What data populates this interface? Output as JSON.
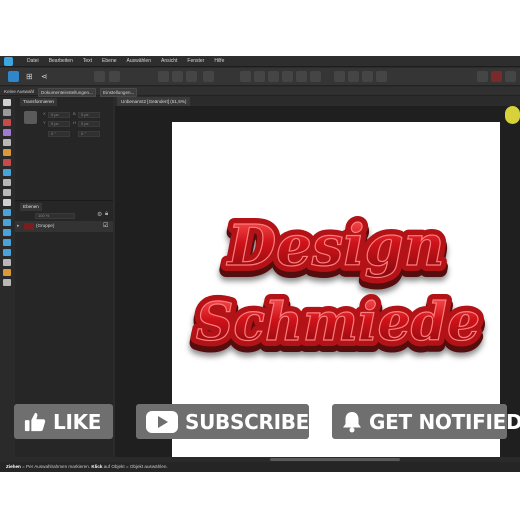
{
  "menubar": {
    "items": [
      "Datei",
      "Bearbeiten",
      "Text",
      "Ebene",
      "Auswählen",
      "Ansicht",
      "Fenster",
      "Hilfe"
    ]
  },
  "contextbar": {
    "selection": "Keine Auswahl",
    "document_settings": "Dokumenteinstellungen...",
    "preferences": "Einstellungen..."
  },
  "panels": {
    "transform_tab": "Transformieren",
    "fields": [
      "0 px",
      "0 px",
      "0 px",
      "0 px",
      "0 °",
      "0 °"
    ],
    "layers_tab": "Ebenen",
    "opacity": "100 %",
    "layer_name": "(Gruppe)"
  },
  "document": {
    "tab_label": "Unbenannt2 [Geändert] (51,5%)"
  },
  "artwork": {
    "line1": "Design",
    "line2": "Schmiede"
  },
  "status": {
    "drag_key": "Ziehen",
    "drag_text": " = Per Auswahlrahmen markieren. ",
    "click_key": "Klick",
    "click_text": " auf Objekt = Objekt auswählen."
  },
  "overlay": {
    "like": "LIKE",
    "subscribe": "SUBSCRIBE",
    "notify": "GET NOTIFIED"
  },
  "colors": {
    "accent": "#3da5e0",
    "artwork_red": "#c4161c",
    "button_gray": "#6f6f6f"
  }
}
